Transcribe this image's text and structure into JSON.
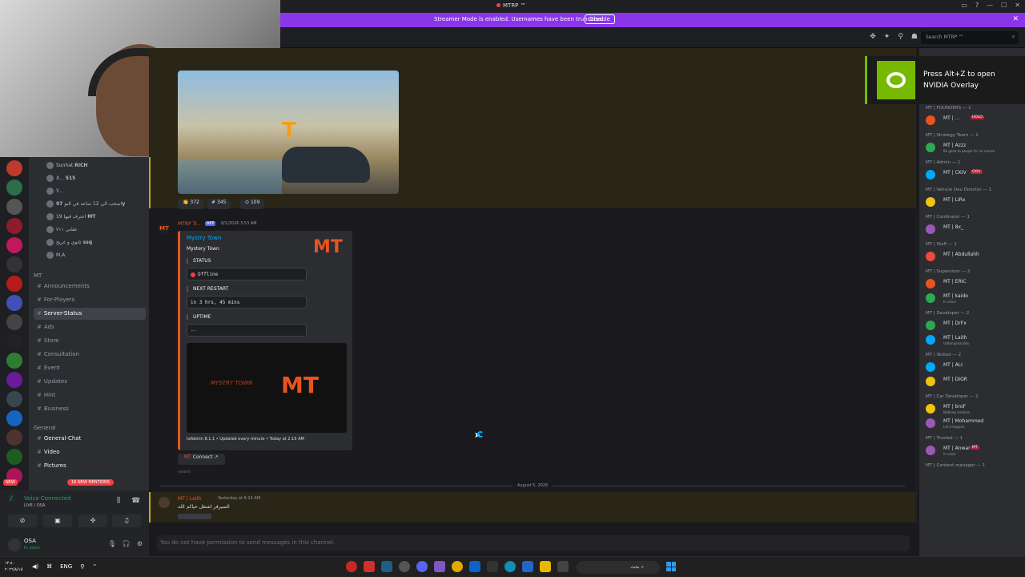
{
  "window": {
    "title": "MTRP ™"
  },
  "streamer_bar": {
    "message": "Streamer Mode is enabled. Usernames have been truncated.",
    "disable_label": "Disable",
    "close_icon": "close-icon"
  },
  "header": {
    "search_placeholder": "Search MTRP ™"
  },
  "voice_channel_users": [
    {
      "name": "Sunhat",
      "tag": "RICH"
    },
    {
      "name": "X...",
      "tag": "515"
    },
    {
      "name": "Y..."
    },
    {
      "name": "اسحب الي 12 ساعه في النو",
      "tag": "97y"
    },
    {
      "name": "اعترف فيها 19",
      "tag": "MT"
    },
    {
      "name": "عقابي ٧١١",
      "tag": ""
    },
    {
      "name": "ثانوي و غريخ",
      "tag": "ssq"
    },
    {
      "name": "M.A"
    }
  ],
  "channels": {
    "category_mt": "MT",
    "items": [
      {
        "label": "Announcements"
      },
      {
        "label": "For-Players"
      },
      {
        "label": "Server-Status"
      },
      {
        "label": "Ads"
      },
      {
        "label": "Store"
      },
      {
        "label": "Consultation"
      },
      {
        "label": "Event"
      },
      {
        "label": "Updates"
      },
      {
        "label": "Hint"
      },
      {
        "label": "Business"
      }
    ],
    "category_general": "General",
    "general_items": [
      {
        "label": "General-Chat"
      },
      {
        "label": "Video"
      },
      {
        "label": "Pictures"
      }
    ],
    "new_badge": "NEW",
    "mentions_badge": "16 NEW MENTIONS"
  },
  "voice_panel": {
    "status": "Voice Connected",
    "sub": "LIVE / OSA"
  },
  "user_panel": {
    "name": "OSA",
    "status": "In voice"
  },
  "reactions": [
    {
      "emoji": "👏",
      "count": "372"
    },
    {
      "emoji": "#",
      "count": "345"
    },
    {
      "emoji": "⊙",
      "count": "109"
    }
  ],
  "bot_message": {
    "avatar_text": "MT",
    "author": "MTRP Tr...",
    "badge": "APP",
    "time": "8/1/2026 3:53 AM",
    "embed": {
      "author": "Mystry Town",
      "title": "Mystery Town",
      "thumb_text": "MT",
      "fields": [
        {
          "name": "STATUS",
          "value": "Offline"
        },
        {
          "name": "NEXT RESTART",
          "value": "in 3 hrs, 45 mins"
        },
        {
          "name": "UPTIME",
          "value": "--"
        }
      ],
      "image_logo": "MT",
      "image_text": "MYSTRY TOWN",
      "footer": "txAdmin 8.1.1 • Updated every minute • Today at 2:15 AM"
    },
    "connect_label": "Connect",
    "edited": "(edited)"
  },
  "divider_date": "August 5, 2026",
  "message2": {
    "author": "MT | Laith",
    "time": "Yesterday at 6:14 AM",
    "text": "السيرفر اشتغل حياكم الله"
  },
  "composer": {
    "placeholder": "You do not have permission to send messages in this channel."
  },
  "members": [
    {
      "role": "MT | FOUNDERS — 1",
      "users": [
        {
          "name": "MT | ...",
          "tag": "HOLO"
        }
      ]
    },
    {
      "role": "MT | Strategy Team — 1",
      "users": [
        {
          "name": "MT | Azzz",
          "sub": "Be good to people for no reason"
        }
      ]
    },
    {
      "role": "MT | Admin — 1",
      "users": [
        {
          "name": "MT | CKIV",
          "tag": "CKIV"
        }
      ]
    },
    {
      "role": "MT | Vehicle Dev Director — 1",
      "users": [
        {
          "name": "MT | LiRx"
        }
      ]
    },
    {
      "role": "MT | Cordinator — 1",
      "users": [
        {
          "name": "MT | 8x_"
        }
      ]
    },
    {
      "role": "MT | Staff — 1",
      "users": [
        {
          "name": "MT | Abdullahh"
        }
      ]
    },
    {
      "role": "MT | Supervisor — 2",
      "users": [
        {
          "name": "MT | ERIC"
        },
        {
          "name": "MT | kaido",
          "sub": "In voice"
        }
      ]
    },
    {
      "role": "MT | Developer — 2",
      "users": [
        {
          "name": "MT | DrFx"
        },
        {
          "name": "MT | Laith",
          "sub": "laithmaahal.dev"
        }
      ]
    },
    {
      "role": "MT | Skilled — 2",
      "users": [
        {
          "name": "MT | ALI"
        },
        {
          "name": "MT | DIOR"
        }
      ]
    },
    {
      "role": "MT | Car Developer — 2",
      "users": [
        {
          "name": "MT | broF",
          "sub": "Nothing remains."
        },
        {
          "name": "MT | Mohammed",
          "sub": "Let it happen."
        }
      ]
    },
    {
      "role": "MT | Trusted — 1",
      "users": [
        {
          "name": "MT | Anwar",
          "tag": "MT",
          "sub": "In voice"
        }
      ]
    },
    {
      "role": "MT | Content manager — 1",
      "users": []
    }
  ],
  "nvidia": {
    "line1": "Press Alt+Z to open",
    "line2": "NVIDIA Overlay"
  },
  "taskbar": {
    "time": "١٢:٤٠",
    "date": "٢٠٢٦/٨/١٥",
    "lang": "ENG",
    "search": "بحث"
  },
  "colors": {
    "accent": "#8a36e8",
    "bot_orange": "#e8541f",
    "highlight": "#2a2617",
    "link": "#00a8fc",
    "online": "#23a55a"
  }
}
